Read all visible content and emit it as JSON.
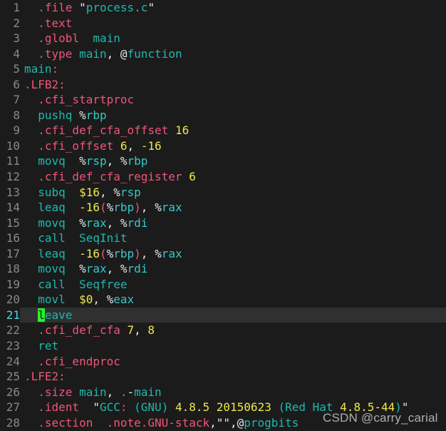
{
  "editor": {
    "background": "#1b1b1b",
    "gutter_color": "#8a8a80",
    "cursor_line_background": "#303030",
    "cursor_color": "#25f525",
    "cursor_line_number": 21,
    "total_lines": 28,
    "language": "assembly",
    "palette": {
      "directive": "#f0557a",
      "instruction": "#1fb8ac",
      "register": "#38c8c8",
      "number": "#ece94a",
      "punctuation": "#e8e8e8"
    },
    "lines": [
      {
        "n": "1",
        "text": "  .file \"process.c\""
      },
      {
        "n": "2",
        "text": "  .text"
      },
      {
        "n": "3",
        "text": "  .globl  main"
      },
      {
        "n": "4",
        "text": "  .type main, @function"
      },
      {
        "n": "5",
        "text": "main:"
      },
      {
        "n": "6",
        "text": ".LFB2:"
      },
      {
        "n": "7",
        "text": "  .cfi_startproc"
      },
      {
        "n": "8",
        "text": "  pushq %rbp"
      },
      {
        "n": "9",
        "text": "  .cfi_def_cfa_offset 16"
      },
      {
        "n": "10",
        "text": "  .cfi_offset 6, -16"
      },
      {
        "n": "11",
        "text": "  movq  %rsp, %rbp"
      },
      {
        "n": "12",
        "text": "  .cfi_def_cfa_register 6"
      },
      {
        "n": "13",
        "text": "  subq  $16, %rsp"
      },
      {
        "n": "14",
        "text": "  leaq  -16(%rbp), %rax"
      },
      {
        "n": "15",
        "text": "  movq  %rax, %rdi"
      },
      {
        "n": "16",
        "text": "  call  SeqInit"
      },
      {
        "n": "17",
        "text": "  leaq  -16(%rbp), %rax"
      },
      {
        "n": "18",
        "text": "  movq  %rax, %rdi"
      },
      {
        "n": "19",
        "text": "  call  Seqfree"
      },
      {
        "n": "20",
        "text": "  movl  $0, %eax"
      },
      {
        "n": "21",
        "text": "  leave"
      },
      {
        "n": "22",
        "text": "  .cfi_def_cfa 7, 8"
      },
      {
        "n": "23",
        "text": "  ret"
      },
      {
        "n": "24",
        "text": "  .cfi_endproc"
      },
      {
        "n": "25",
        "text": ".LFE2:"
      },
      {
        "n": "26",
        "text": "  .size main, .-main"
      },
      {
        "n": "27",
        "text": "  .ident  \"GCC: (GNU) 4.8.5 20150623 (Red Hat 4.8.5-44)\""
      },
      {
        "n": "28",
        "text": "  .section  .note.GNU-stack,\"\",@progbits"
      }
    ]
  },
  "watermark": {
    "text": "CSDN @carry_carial"
  }
}
